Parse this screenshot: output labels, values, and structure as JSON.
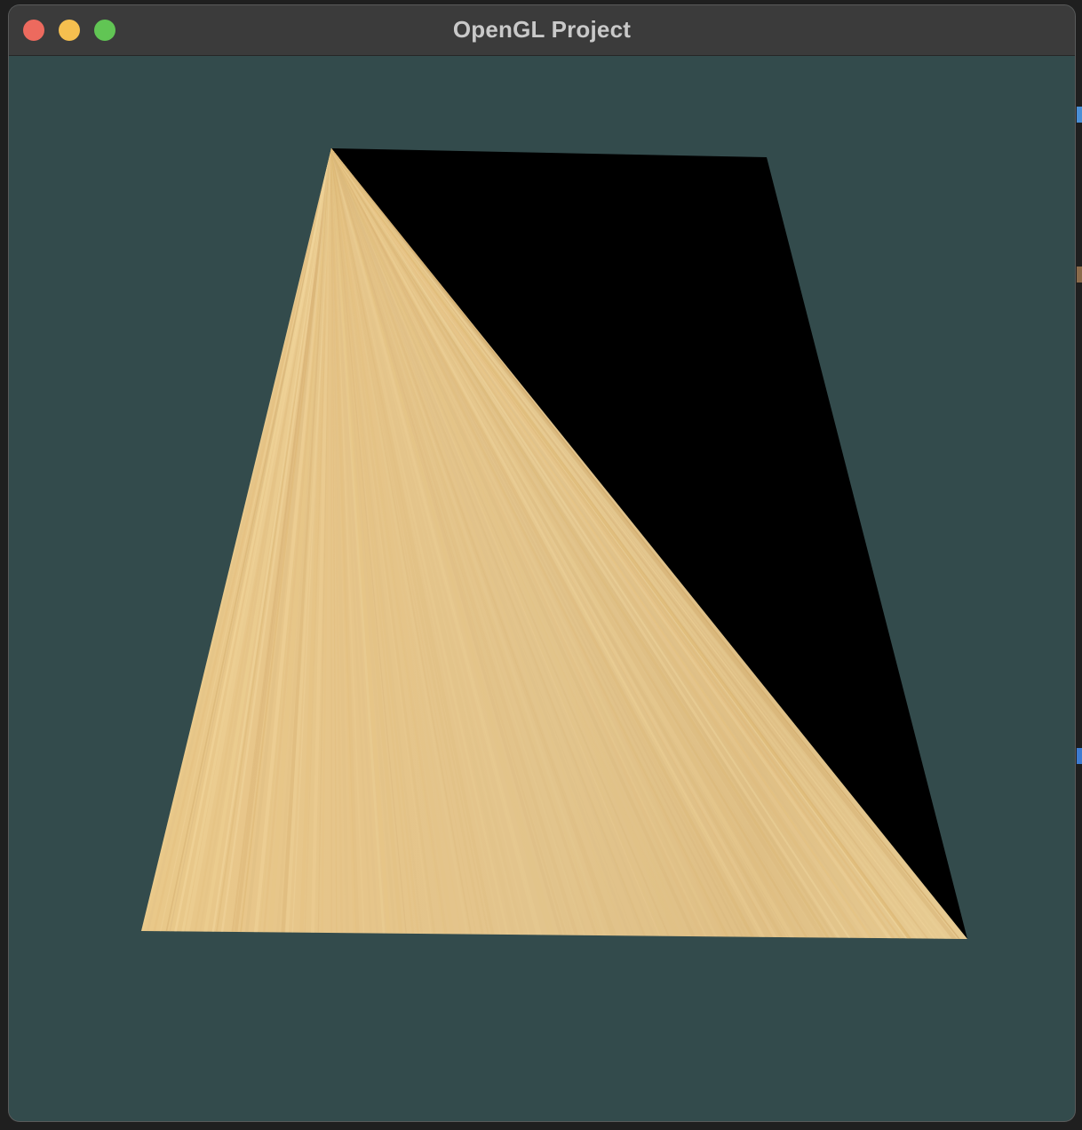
{
  "window": {
    "title": "OpenGL Project"
  },
  "render": {
    "clear_color": "#334b4c",
    "textured_triangle": {
      "texture": "wood-grain",
      "base_color": "#e3c48a"
    },
    "untextured_triangle_color": "#000000"
  },
  "controls": {
    "close_icon": "close-icon",
    "minimize_icon": "minimize-icon",
    "zoom_icon": "zoom-icon"
  }
}
